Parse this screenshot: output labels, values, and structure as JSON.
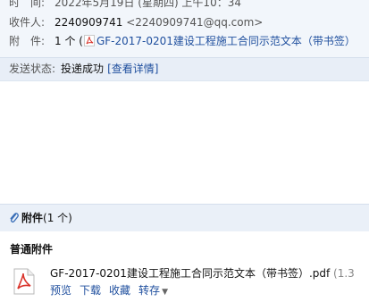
{
  "header": {
    "time_label": "时　间:",
    "time_value": "2022年5月19日 (星期四) 上午10：34",
    "recipient_label": "收件人:",
    "recipient_name": "2240909741",
    "recipient_email": "<2240909741@qq.com>",
    "attachment_label": "附　件:",
    "attachment_count": "1 个",
    "attachment_paren_open": "(",
    "attachment_link": "GF-2017-0201建设工程施工合同示范文本（带书签）"
  },
  "status": {
    "label": "发送状态:",
    "value": "投递成功",
    "details_link": "[查看详情]"
  },
  "attachments": {
    "title": "附件",
    "count": "(1 个)",
    "section_label": "普通附件",
    "file_name": "GF-2017-0201建设工程施工合同示范文本（带书签）.pdf",
    "file_size": "(1.3",
    "actions": {
      "preview": "预览",
      "download": "下载",
      "favorite": "收藏",
      "forward": "转存"
    }
  },
  "colors": {
    "link": "#1f4f9e",
    "pdf_red": "#d9332b"
  }
}
